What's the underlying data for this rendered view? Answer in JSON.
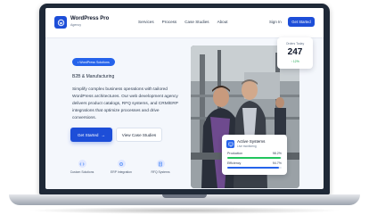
{
  "brand": {
    "name": "WordPress Pro",
    "sub": "Agency"
  },
  "nav": {
    "links": [
      "Services",
      "Process",
      "Case Studies",
      "About"
    ],
    "signin": "Sign In",
    "cta": "Get Started"
  },
  "hero": {
    "badge": "• WordPress Solutions",
    "subtitle": "B2B & Manufacturing",
    "text": "Simplify complex business operations with tailored WordPress architectures. Our web development agency delivers product catalogs, RFQ systems, and CRM/ERP integrations that optimize processes and drive conversions.",
    "primary_button": "Get Started",
    "secondary_button": "View Case Studies"
  },
  "features": [
    {
      "label": "Custom Solutions",
      "icon": "code-icon"
    },
    {
      "label": "ERP Integration",
      "icon": "gear-icon"
    },
    {
      "label": "RFQ Systems",
      "icon": "document-icon"
    }
  ],
  "orders_card": {
    "label": "Orders Today",
    "value": "247",
    "change": "↑ 12%"
  },
  "systems_card": {
    "title": "Active Systems",
    "sub": "Live monitoring",
    "rows": [
      {
        "label": "Production",
        "value": "98.2%",
        "level": 0.982
      },
      {
        "label": "Efficiency",
        "value": "94.7%",
        "level": 0.947
      }
    ]
  },
  "colors": {
    "accent": "#1d4ed8",
    "success": "#22c55e",
    "background": "#f4f7fc"
  }
}
